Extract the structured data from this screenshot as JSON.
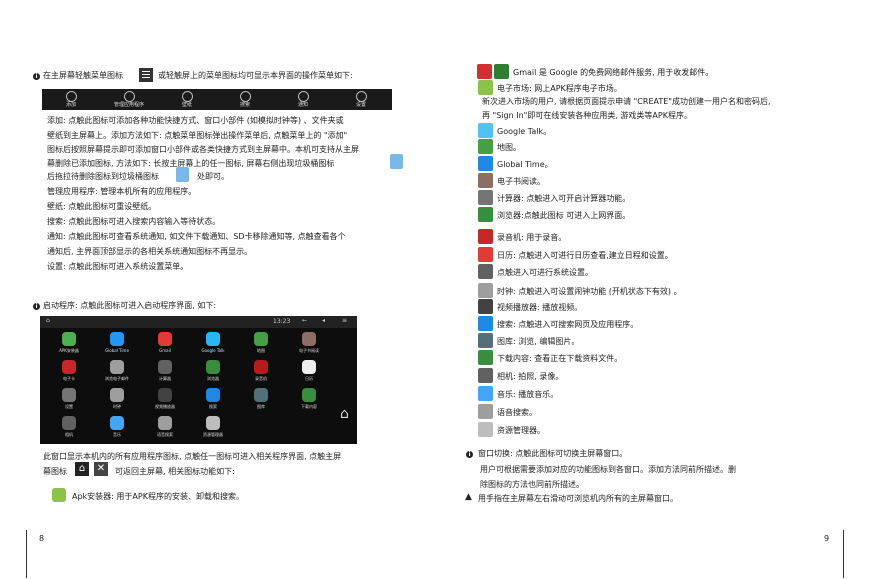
{
  "left": {
    "intro": "在主屏幕轻触菜单图标",
    "intro2": "或轻触屏上的菜单图标均可显示本界面的操作菜单如下:",
    "menu_items": [
      "添加",
      "管理应用程序",
      "壁纸",
      "搜索",
      "通知",
      "设置"
    ],
    "para1": [
      "添加: 点触此图标可添加各种功能快捷方式、窗口小部件 (如模拟时钟等) 、文件夹或",
      "壁纸到主屏幕上。添加方法如下: 点触菜单图标弹出操作菜单后, 点触菜单上的 \"添加\"",
      "图标后按照屏幕提示即可添加窗口小部件或各类快捷方式到主屏幕中。本机可支持从主屏",
      "幕删除已添加图标, 方法如下: 长按主屏幕上的任一图标, 屏幕右侧出现垃圾桶图标",
      "后拖拉待删除图标到垃圾桶图标",
      "处即可。"
    ],
    "defs": [
      "管理应用程序: 管理本机所有的应用程序。",
      "壁纸: 点触此图标可重设壁纸。",
      "搜索: 点触此图标可进入搜索内容输入等待状态。",
      "通知: 点触此图标可查看系统通知, 如文件下载通知、SD卡移除通知等, 点触查看各个",
      "通知后, 主界面顶部显示的各相关系统通知图标不再显示。",
      "设置: 点触此图标可进入系统设置菜单。"
    ],
    "launch": "启动程序: 点触此图标可进入启动程序界面, 如下:",
    "status_time": "13:23",
    "apps": [
      "APK安装器",
      "Global Time",
      "Gmail",
      "Google Talk",
      "地图",
      "电子书阅读",
      "电子卡",
      "浏览电子邮件",
      "计算器",
      "浏览器",
      "录音机",
      "日历",
      "设置",
      "时钟",
      "视频播放器",
      "搜索",
      "图库",
      "下载内容",
      "相机",
      "音乐",
      "语音搜索",
      "资源管理器"
    ],
    "bottom1": "此窗口显示本机内的所有应用程序图标, 点触任一图标可进入相关程序界面, 点触主屏",
    "bottom2a": "幕图标",
    "bottom2b": "可返回主屏幕, 相关图标功能如下:",
    "apk": "Apk安装器: 用于APK程序的安装、卸载和搜索。",
    "page_num": "8"
  },
  "right": {
    "items": [
      "Gmail 是 Google 的免费网络邮件服务, 用于收发邮件。",
      "电子市场: 网上APK程序电子市场。",
      "新次进入市场的用户, 请根据页面提示申请 \"CREATE\"成功创建一用户名和密码后,",
      "再 \"Sign In\"即可在线安装各种应用类, 游戏类等APK程序。",
      "Google Talk。",
      "地图。",
      "Global Time。",
      "电子书阅读。",
      "计算器: 点触进入可开启计算器功能。",
      "浏览器:点触此图标 可进入上网界面。",
      "录音机: 用于录音。",
      "日历: 点触进入可进行日历查看,建立日程和设置。",
      "点触进入可进行系统设置。",
      "时钟: 点触进入可设置闹钟功能 (开机状态下有效) 。",
      "视频播放器: 播放视频。",
      "搜索: 点触进入可搜索网页及应用程序。",
      "图库: 浏览, 编辑图片。",
      "下载内容: 查看正在下载资料文件。",
      "相机: 拍照, 录像。",
      "音乐: 播放音乐。",
      "语音搜索。",
      "资源管理器。"
    ],
    "window": "窗口切换: 点触此图标可切换主屏幕窗口。",
    "window2": "用户可根据需要添加对应的功能图标到各窗口。添加方法同前所描述。删",
    "window3": "除图标的方法也同前所描述。",
    "warn": "用手指在主屏幕左右滑动可浏览机内所有的主屏幕窗口。",
    "page_num": "9"
  }
}
